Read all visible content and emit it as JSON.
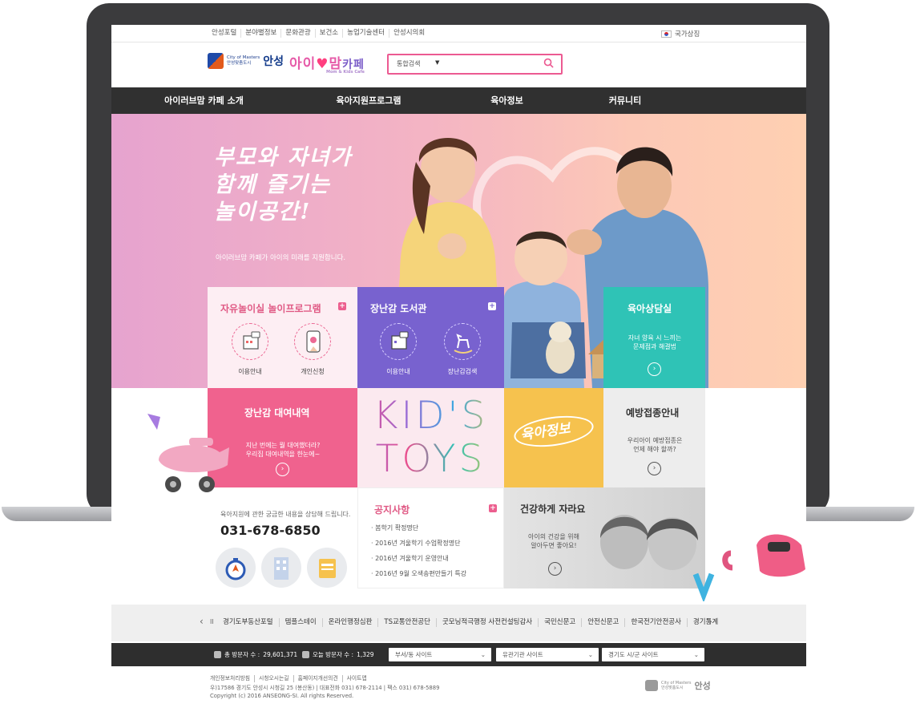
{
  "topnav": {
    "links": [
      "안성포털",
      "분야별정보",
      "문화관광",
      "보건소",
      "농업기술센터",
      "안성시의회"
    ],
    "lang": "국가상징"
  },
  "logo": {
    "city_en": "City of Masters",
    "city_sub": "안성맞춤도시",
    "city_name": "안성",
    "cafe_a": "아이",
    "cafe_b": "맘",
    "cafe_c": "카페",
    "cafe_sub": "Mom & Kids Cafe"
  },
  "search": {
    "category": "통합검색",
    "arrow": "▼"
  },
  "gnb": [
    "아이러브맘 카페 소개",
    "육아지원프로그램",
    "육아정보",
    "커뮤니티"
  ],
  "hero": {
    "line1": "부모와 자녀가",
    "line2": "함께 즐기는",
    "line3": "놀이공간!",
    "sub": "아이러브맘 카페가 아이의 미래를 지원합니다."
  },
  "tiles": {
    "free_play": {
      "title": "자유놀이실 놀이프로그램",
      "plus": "+",
      "item1": "이용안내",
      "item2": "개인신청"
    },
    "toy_library": {
      "title": "장난감 도서관",
      "plus": "+",
      "item1": "이용안내",
      "item2": "장난감검색"
    },
    "counsel": {
      "title": "육아상담실",
      "desc1": "자녀 양육 시 느끼는",
      "desc2": "문제점과 해결법"
    },
    "rental": {
      "title": "장난감 대여내역",
      "desc1": "지난 번에는 뭘 대여했더라?",
      "desc2": "우리집 대여내역을 한눈에~"
    },
    "kids": {
      "line1": "KID'S",
      "line2": "TOYS"
    },
    "parenting": {
      "badge": "육아정보"
    },
    "vaccine": {
      "title": "예방접종안내",
      "desc1": "우리아이 예방접종은",
      "desc2": "언제 해야 할까?"
    },
    "notice": {
      "title": "공지사항",
      "plus": "+",
      "items": [
        "봄학기 확정명단",
        "2016년 겨울학기 수업확정명단",
        "2016년 겨울학기 운영안내",
        "2016년 9월 오색송편만들기 특강"
      ]
    },
    "healthy": {
      "title": "건강하게 자라요",
      "desc1": "아이의 건강을 위해",
      "desc2": "알아두면 좋아요!"
    }
  },
  "contact": {
    "label": "육아지원에 관한 궁금한 내용을 상담해 드립니다.",
    "phone": "031-678-6850"
  },
  "related": {
    "prev": "‹",
    "pause": "II",
    "next": "›",
    "items": [
      "경기도부동산포털",
      "템플스테이",
      "온라인행정심판",
      "TS교통안전공단",
      "굿모닝적극행정 사전컨설팅감사",
      "국민신문고",
      "안전신문고",
      "한국전기안전공사",
      "경기통계"
    ]
  },
  "footbar": {
    "total_label": "총 방문자 수 :",
    "total": "29,601,371",
    "today_label": "오늘 방문자 수 :",
    "today": "1,329",
    "sel1": "부서/동 사이트",
    "sel2": "유관기관 사이트",
    "sel3": "경기도 시/군 사이트"
  },
  "footer": {
    "links": [
      "개인정보처리방침",
      "시청오시는길",
      "홈페이지개선의견",
      "사이트맵"
    ],
    "address": "우)17586 경기도 안성시 시청길 25 (봉산동) | 대표전화 031) 678-2114 | 팩스 031) 678-5889",
    "copyright": "Copyright (c) 2016 ANSEONG-SI. All rights Reserved.",
    "logo_en": "City of Masters",
    "logo_sub": "안성맞춤도시",
    "logo_name": "안성"
  },
  "colors": {
    "pink": "#f0628e",
    "purple": "#7a5ed0",
    "teal": "#2fc3b6",
    "yellow": "#f6c24e",
    "dark": "#303030"
  }
}
